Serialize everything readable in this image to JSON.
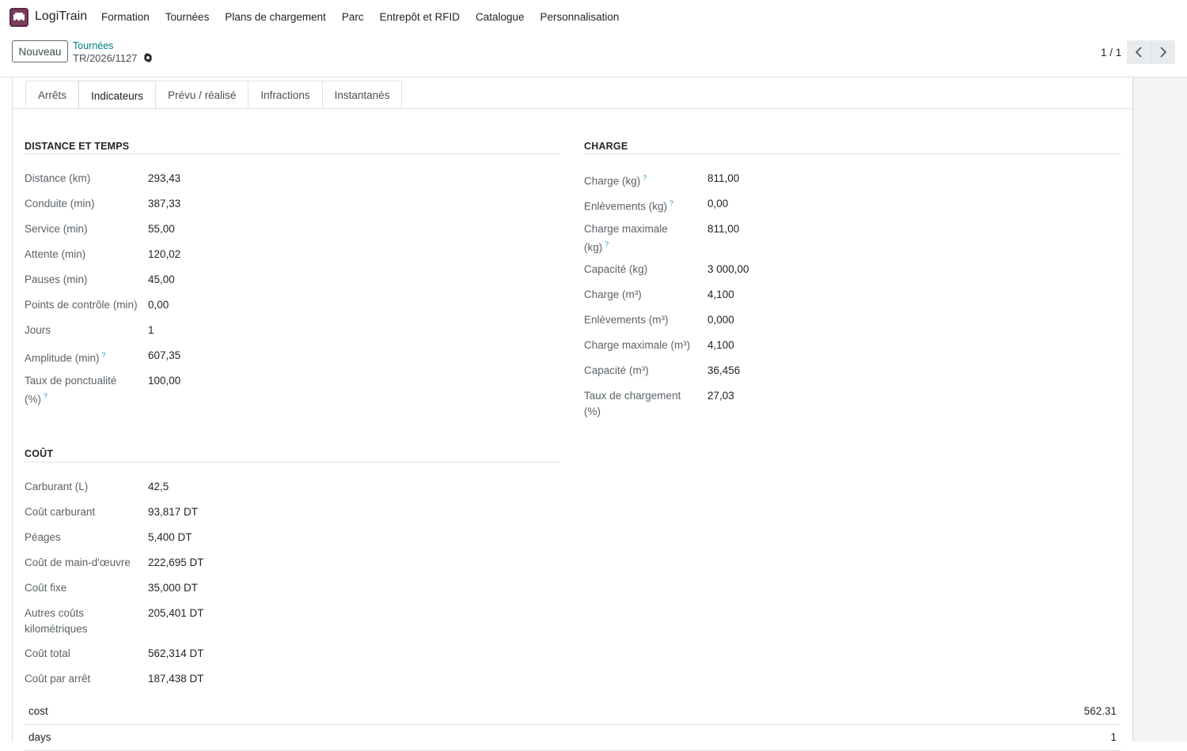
{
  "app": {
    "name": "LogiTrain"
  },
  "menu": [
    "Formation",
    "Tournées",
    "Plans de chargement",
    "Parc",
    "Entrepôt et RFID",
    "Catalogue",
    "Personnalisation"
  ],
  "control": {
    "new_label": "Nouveau",
    "breadcrumb": "Tournées",
    "record": "TR/2026/1127",
    "pager": "1 / 1"
  },
  "tabs": [
    "Arrêts",
    "Indicateurs",
    "Prévu / réalisé",
    "Infractions",
    "Instantanés"
  ],
  "active_tab": "Indicateurs",
  "sections": {
    "distance": {
      "title": "DISTANCE ET TEMPS",
      "fields": [
        {
          "label": "Distance (km)",
          "value": "293,43",
          "help": false
        },
        {
          "label": "Conduite (min)",
          "value": "387,33",
          "help": false
        },
        {
          "label": "Service (min)",
          "value": "55,00",
          "help": false
        },
        {
          "label": "Attente (min)",
          "value": "120,02",
          "help": false
        },
        {
          "label": "Pauses (min)",
          "value": "45,00",
          "help": false
        },
        {
          "label": "Points de contrôle (min)",
          "value": "0,00",
          "help": false
        },
        {
          "label": "Jours",
          "value": "1",
          "help": false
        },
        {
          "label": "Amplitude (min)",
          "value": "607,35",
          "help": true
        },
        {
          "label": "Taux de ponctualité (%)",
          "value": "100,00",
          "help": true
        }
      ]
    },
    "charge": {
      "title": "CHARGE",
      "fields": [
        {
          "label": "Charge (kg)",
          "value": "811,00",
          "help": true
        },
        {
          "label": "Enlèvements (kg)",
          "value": "0,00",
          "help": true
        },
        {
          "label": "Charge maximale (kg)",
          "value": "811,00",
          "help": true
        },
        {
          "label": "Capacité (kg)",
          "value": "3 000,00",
          "help": false
        },
        {
          "label": "Charge (m³)",
          "value": "4,100",
          "help": false
        },
        {
          "label": "Enlèvements (m³)",
          "value": "0,000",
          "help": false
        },
        {
          "label": "Charge maximale (m³)",
          "value": "4,100",
          "help": false
        },
        {
          "label": "Capacité (m³)",
          "value": "36,456",
          "help": false
        },
        {
          "label": "Taux de chargement (%)",
          "value": "27,03",
          "help": false
        }
      ]
    },
    "cout": {
      "title": "COÛT",
      "fields": [
        {
          "label": "Carburant (L)",
          "value": "42,5",
          "help": false
        },
        {
          "label": "Coût carburant",
          "value": "93,817 DT",
          "help": false
        },
        {
          "label": "Péages",
          "value": "5,400 DT",
          "help": false
        },
        {
          "label": "Coût de main-d'œuvre",
          "value": "222,695 DT",
          "help": false
        },
        {
          "label": "Coût fixe",
          "value": "35,000 DT",
          "help": false
        },
        {
          "label": "Autres coûts kilométriques",
          "value": "205,401 DT",
          "help": false
        },
        {
          "label": "Coût total",
          "value": "562,314 DT",
          "help": false
        },
        {
          "label": "Coût par arrêt",
          "value": "187,438 DT",
          "help": false
        }
      ]
    }
  },
  "table_rows": [
    {
      "key": "cost",
      "value": "562.31"
    },
    {
      "key": "days",
      "value": "1"
    }
  ],
  "help_mark": "?",
  "colors": {
    "accent": "#017e84",
    "brand": "#7a3d5c",
    "help": "#2e9ad0"
  }
}
